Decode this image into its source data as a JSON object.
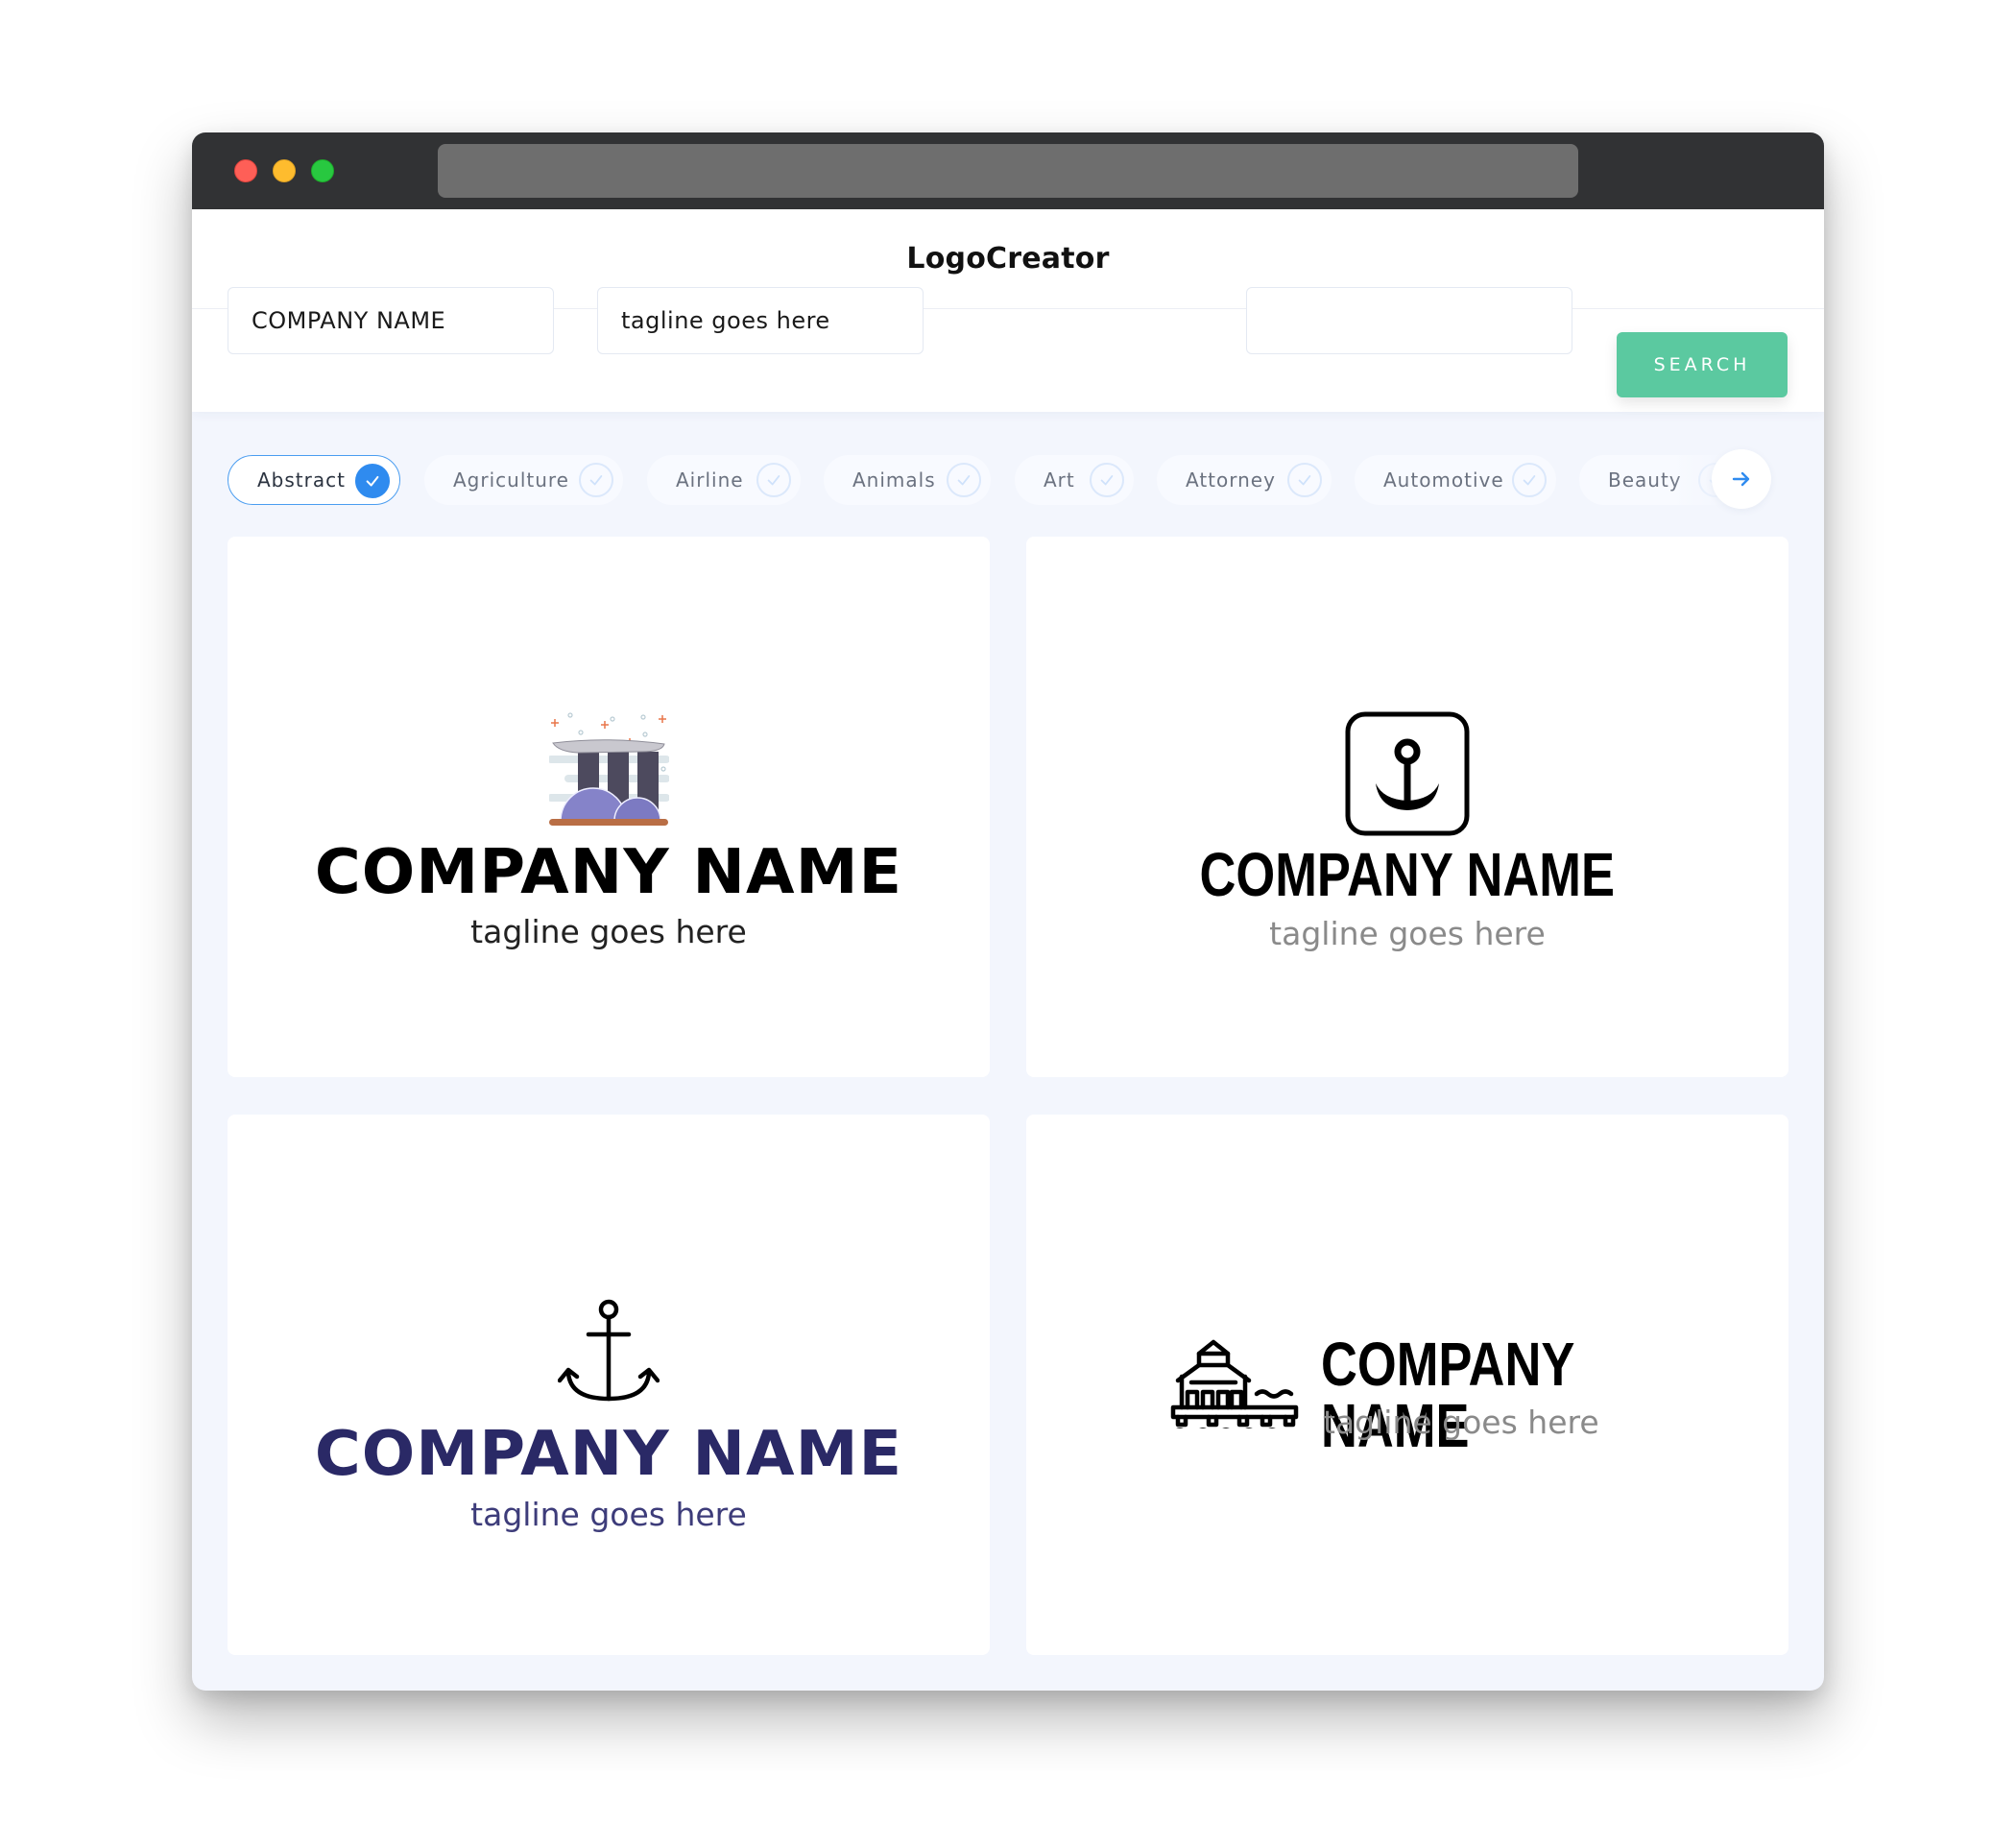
{
  "window": {
    "controls": [
      "close",
      "minimize",
      "maximize"
    ]
  },
  "header": {
    "title": "LogoCreator"
  },
  "search": {
    "company_value": "COMPANY NAME",
    "tagline_value": "tagline goes here",
    "extra_value": "",
    "button_label": "SEARCH"
  },
  "categories": [
    {
      "label": "Abstract",
      "selected": true
    },
    {
      "label": "Agriculture",
      "selected": false
    },
    {
      "label": "Airline",
      "selected": false
    },
    {
      "label": "Animals",
      "selected": false
    },
    {
      "label": "Art",
      "selected": false
    },
    {
      "label": "Attorney",
      "selected": false
    },
    {
      "label": "Automotive",
      "selected": false
    },
    {
      "label": "Beauty",
      "selected": false
    }
  ],
  "colors": {
    "accent_green": "#5bc9a0",
    "accent_blue": "#2f8bef",
    "navy": "#2a2966"
  },
  "logos": [
    {
      "icon": "marina-bay-sands-icon",
      "company": "COMPANY NAME",
      "tagline": "tagline goes here",
      "name_color": "#000000",
      "tagline_color": "#222222"
    },
    {
      "icon": "anchor-square-icon",
      "company": "COMPANY NAME",
      "tagline": "tagline goes here",
      "name_color": "#000000",
      "tagline_color": "#8a8a8a"
    },
    {
      "icon": "anchor-icon",
      "company": "COMPANY NAME",
      "tagline": "tagline goes here",
      "name_color": "#2a2966",
      "tagline_color": "#3d3c7a"
    },
    {
      "icon": "pier-building-icon",
      "company": "COMPANY NAME",
      "tagline": "tagline goes here",
      "name_color": "#000000",
      "tagline_color": "#8a8a8a"
    }
  ]
}
